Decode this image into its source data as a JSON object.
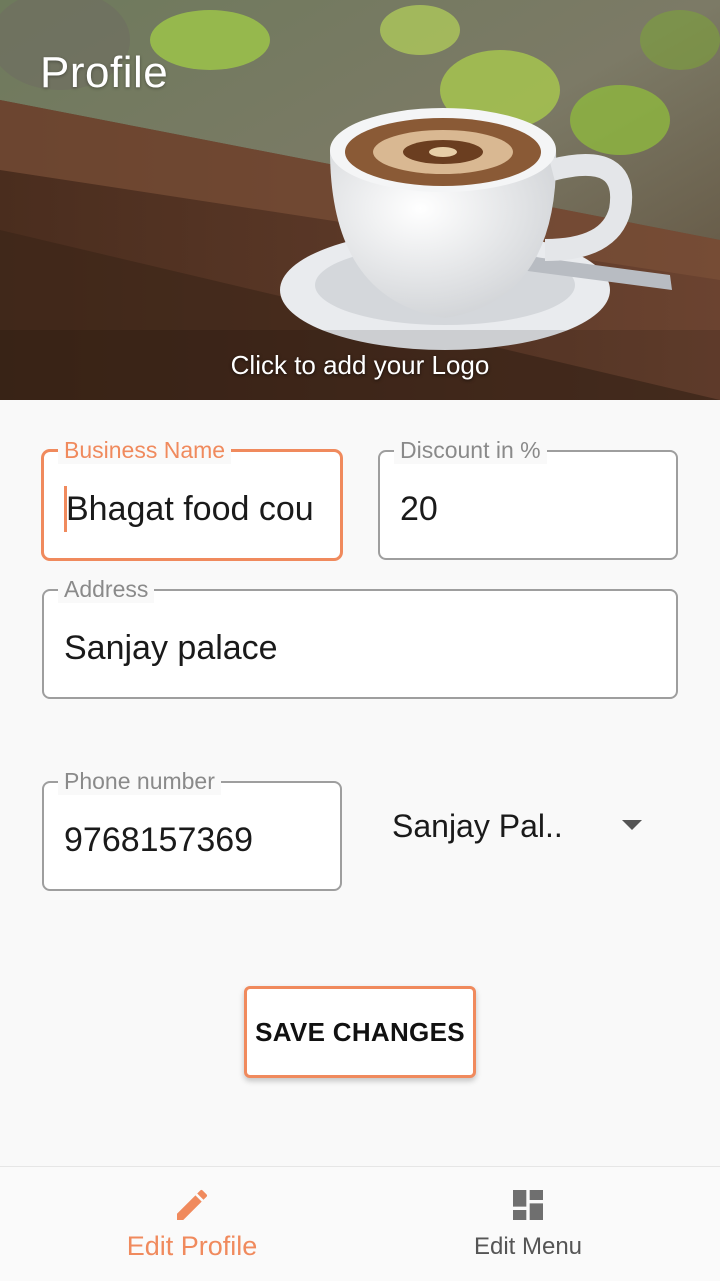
{
  "header": {
    "title": "Profile",
    "logo_hint": "Click to add your Logo"
  },
  "form": {
    "business_name": {
      "label": "Business Name",
      "value": "Bhagat food cou"
    },
    "discount": {
      "label": "Discount in %",
      "value": "20"
    },
    "address": {
      "label": "Address",
      "value": "Sanjay palace"
    },
    "phone": {
      "label": "Phone number",
      "value": "9768157369"
    },
    "location_select": {
      "value": "Sanjay Pal.."
    },
    "save_label": "SAVE CHANGES"
  },
  "bottom_nav": {
    "items": [
      {
        "label": "Edit Profile",
        "icon": "pencil-icon",
        "active": true
      },
      {
        "label": "Edit Menu",
        "icon": "dashboard-icon",
        "active": false
      }
    ]
  },
  "colors": {
    "accent": "#f08a5d",
    "background": "#f9f9f9",
    "border": "#9e9e9e"
  }
}
